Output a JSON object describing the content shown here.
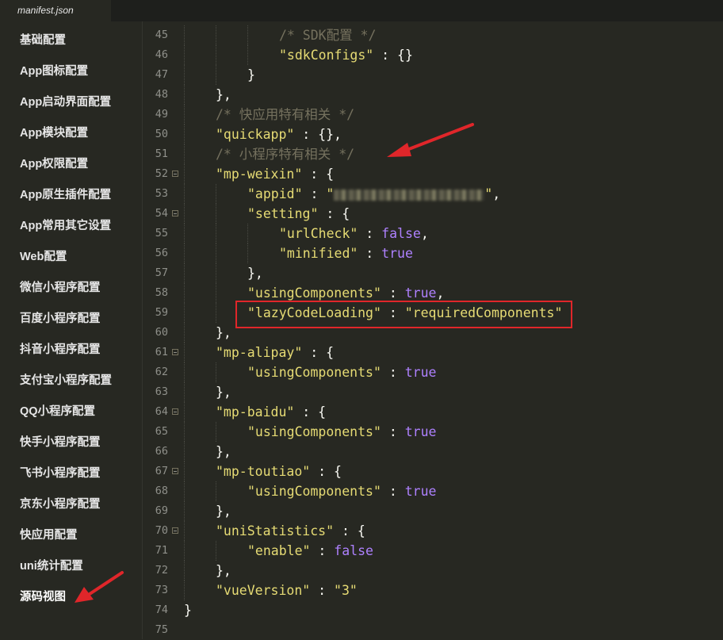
{
  "tab": {
    "label": "manifest.json"
  },
  "sidebar": {
    "items": [
      {
        "label": "基础配置",
        "active": false
      },
      {
        "label": "App图标配置",
        "active": false
      },
      {
        "label": "App启动界面配置",
        "active": false
      },
      {
        "label": "App模块配置",
        "active": false
      },
      {
        "label": "App权限配置",
        "active": false
      },
      {
        "label": "App原生插件配置",
        "active": false
      },
      {
        "label": "App常用其它设置",
        "active": false
      },
      {
        "label": "Web配置",
        "active": false
      },
      {
        "label": "微信小程序配置",
        "active": false
      },
      {
        "label": "百度小程序配置",
        "active": false
      },
      {
        "label": "抖音小程序配置",
        "active": false
      },
      {
        "label": "支付宝小程序配置",
        "active": false
      },
      {
        "label": "QQ小程序配置",
        "active": false
      },
      {
        "label": "快手小程序配置",
        "active": false
      },
      {
        "label": "飞书小程序配置",
        "active": false
      },
      {
        "label": "京东小程序配置",
        "active": false
      },
      {
        "label": "快应用配置",
        "active": false
      },
      {
        "label": "uni统计配置",
        "active": false
      },
      {
        "label": "源码视图",
        "active": true
      }
    ]
  },
  "editor": {
    "lines": [
      {
        "n": "45",
        "fold": false,
        "indent": 3,
        "segs": [
          {
            "t": "/* SDK配置 */",
            "c": "c"
          }
        ]
      },
      {
        "n": "46",
        "fold": false,
        "indent": 3,
        "segs": [
          {
            "t": "\"sdkConfigs\"",
            "c": "k"
          },
          {
            "t": " : {}",
            "c": "p"
          }
        ]
      },
      {
        "n": "47",
        "fold": false,
        "indent": 2,
        "segs": [
          {
            "t": "}",
            "c": "p"
          }
        ]
      },
      {
        "n": "48",
        "fold": false,
        "indent": 1,
        "segs": [
          {
            "t": "},",
            "c": "p"
          }
        ]
      },
      {
        "n": "49",
        "fold": false,
        "indent": 1,
        "segs": [
          {
            "t": "/* 快应用特有相关 */",
            "c": "c"
          }
        ]
      },
      {
        "n": "50",
        "fold": false,
        "indent": 1,
        "segs": [
          {
            "t": "\"quickapp\"",
            "c": "k"
          },
          {
            "t": " : {},",
            "c": "p"
          }
        ]
      },
      {
        "n": "51",
        "fold": false,
        "indent": 1,
        "segs": [
          {
            "t": "/* 小程序特有相关 */",
            "c": "c"
          }
        ]
      },
      {
        "n": "52",
        "fold": true,
        "indent": 1,
        "segs": [
          {
            "t": "\"mp-weixin\"",
            "c": "k"
          },
          {
            "t": " : {",
            "c": "p"
          }
        ]
      },
      {
        "n": "53",
        "fold": false,
        "indent": 2,
        "segs": [
          {
            "t": "\"appid\"",
            "c": "k"
          },
          {
            "t": " : ",
            "c": "p"
          },
          {
            "t": "\"",
            "c": "s"
          },
          {
            "t": "",
            "c": "blur"
          },
          {
            "t": "\"",
            "c": "s"
          },
          {
            "t": ",",
            "c": "p"
          }
        ]
      },
      {
        "n": "54",
        "fold": true,
        "indent": 2,
        "segs": [
          {
            "t": "\"setting\"",
            "c": "k"
          },
          {
            "t": " : {",
            "c": "p"
          }
        ]
      },
      {
        "n": "55",
        "fold": false,
        "indent": 3,
        "segs": [
          {
            "t": "\"urlCheck\"",
            "c": "k"
          },
          {
            "t": " : ",
            "c": "p"
          },
          {
            "t": "false",
            "c": "b"
          },
          {
            "t": ",",
            "c": "p"
          }
        ]
      },
      {
        "n": "56",
        "fold": false,
        "indent": 3,
        "segs": [
          {
            "t": "\"minified\"",
            "c": "k"
          },
          {
            "t": " : ",
            "c": "p"
          },
          {
            "t": "true",
            "c": "b"
          }
        ]
      },
      {
        "n": "57",
        "fold": false,
        "indent": 2,
        "segs": [
          {
            "t": "},",
            "c": "p"
          }
        ]
      },
      {
        "n": "58",
        "fold": false,
        "indent": 2,
        "segs": [
          {
            "t": "\"usingComponents\"",
            "c": "k"
          },
          {
            "t": " : ",
            "c": "p"
          },
          {
            "t": "true",
            "c": "b"
          },
          {
            "t": ",",
            "c": "p"
          }
        ]
      },
      {
        "n": "59",
        "fold": false,
        "indent": 2,
        "segs": [
          {
            "t": "\"lazyCodeLoading\"",
            "c": "k"
          },
          {
            "t": " : ",
            "c": "p"
          },
          {
            "t": "\"requiredComponents\"",
            "c": "s"
          }
        ]
      },
      {
        "n": "60",
        "fold": false,
        "indent": 1,
        "segs": [
          {
            "t": "},",
            "c": "p"
          }
        ]
      },
      {
        "n": "61",
        "fold": true,
        "indent": 1,
        "segs": [
          {
            "t": "\"mp-alipay\"",
            "c": "k"
          },
          {
            "t": " : {",
            "c": "p"
          }
        ]
      },
      {
        "n": "62",
        "fold": false,
        "indent": 2,
        "segs": [
          {
            "t": "\"usingComponents\"",
            "c": "k"
          },
          {
            "t": " : ",
            "c": "p"
          },
          {
            "t": "true",
            "c": "b"
          }
        ]
      },
      {
        "n": "63",
        "fold": false,
        "indent": 1,
        "segs": [
          {
            "t": "},",
            "c": "p"
          }
        ]
      },
      {
        "n": "64",
        "fold": true,
        "indent": 1,
        "segs": [
          {
            "t": "\"mp-baidu\"",
            "c": "k"
          },
          {
            "t": " : {",
            "c": "p"
          }
        ]
      },
      {
        "n": "65",
        "fold": false,
        "indent": 2,
        "segs": [
          {
            "t": "\"usingComponents\"",
            "c": "k"
          },
          {
            "t": " : ",
            "c": "p"
          },
          {
            "t": "true",
            "c": "b"
          }
        ]
      },
      {
        "n": "66",
        "fold": false,
        "indent": 1,
        "segs": [
          {
            "t": "},",
            "c": "p"
          }
        ]
      },
      {
        "n": "67",
        "fold": true,
        "indent": 1,
        "segs": [
          {
            "t": "\"mp-toutiao\"",
            "c": "k"
          },
          {
            "t": " : {",
            "c": "p"
          }
        ]
      },
      {
        "n": "68",
        "fold": false,
        "indent": 2,
        "segs": [
          {
            "t": "\"usingComponents\"",
            "c": "k"
          },
          {
            "t": " : ",
            "c": "p"
          },
          {
            "t": "true",
            "c": "b"
          }
        ]
      },
      {
        "n": "69",
        "fold": false,
        "indent": 1,
        "segs": [
          {
            "t": "},",
            "c": "p"
          }
        ]
      },
      {
        "n": "70",
        "fold": true,
        "indent": 1,
        "segs": [
          {
            "t": "\"uniStatistics\"",
            "c": "k"
          },
          {
            "t": " : {",
            "c": "p"
          }
        ]
      },
      {
        "n": "71",
        "fold": false,
        "indent": 2,
        "segs": [
          {
            "t": "\"enable\"",
            "c": "k"
          },
          {
            "t": " : ",
            "c": "p"
          },
          {
            "t": "false",
            "c": "b"
          }
        ]
      },
      {
        "n": "72",
        "fold": false,
        "indent": 1,
        "segs": [
          {
            "t": "},",
            "c": "p"
          }
        ]
      },
      {
        "n": "73",
        "fold": false,
        "indent": 1,
        "segs": [
          {
            "t": "\"vueVersion\"",
            "c": "k"
          },
          {
            "t": " : ",
            "c": "p"
          },
          {
            "t": "\"3\"",
            "c": "s"
          }
        ]
      },
      {
        "n": "74",
        "fold": false,
        "indent": 0,
        "segs": [
          {
            "t": "}",
            "c": "p"
          }
        ]
      },
      {
        "n": "75",
        "fold": false,
        "indent": 0,
        "segs": []
      }
    ]
  },
  "annotations": {
    "highlight_color": "#e0262a",
    "arrow_color": "#e0262a"
  }
}
